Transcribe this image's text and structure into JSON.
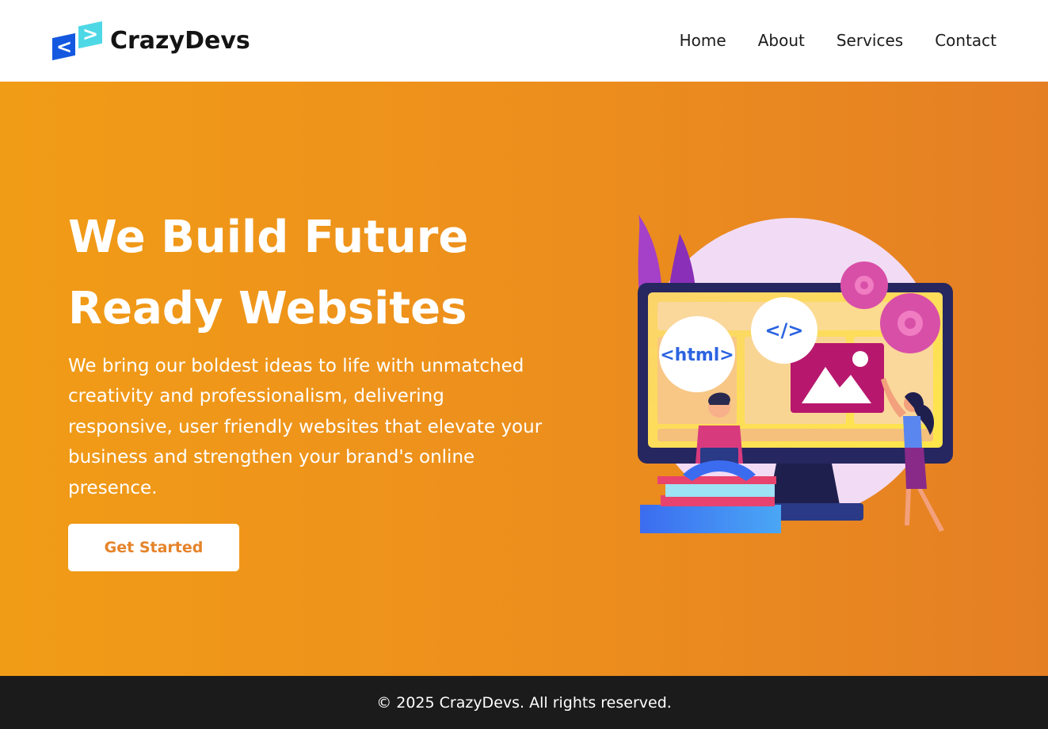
{
  "brand": {
    "name": "CrazyDevs",
    "logo_glyph_left": "<",
    "logo_glyph_right": ">"
  },
  "nav": {
    "items": [
      {
        "label": "Home"
      },
      {
        "label": "About"
      },
      {
        "label": "Services"
      },
      {
        "label": "Contact"
      }
    ]
  },
  "hero": {
    "title_line1": "We Build Future",
    "title_line2": "Ready Websites",
    "description": "We bring our boldest ideas to life with unmatched creativity and professionalism, delivering responsive, user friendly websites that elevate your business and strengthen your brand's online presence.",
    "cta_label": "Get Started",
    "illustration": {
      "html_badge": "<html>",
      "code_badge": "</>"
    }
  },
  "footer": {
    "copyright": "© 2025 CrazyDevs. All rights reserved."
  },
  "colors": {
    "hero_gradient_start": "#f19c17",
    "hero_gradient_end": "#e57f24",
    "cta_text": "#e5832a",
    "logo_blue": "#1458e0",
    "logo_cyan": "#4ed8e6",
    "footer_bg": "#1b1b1b"
  }
}
